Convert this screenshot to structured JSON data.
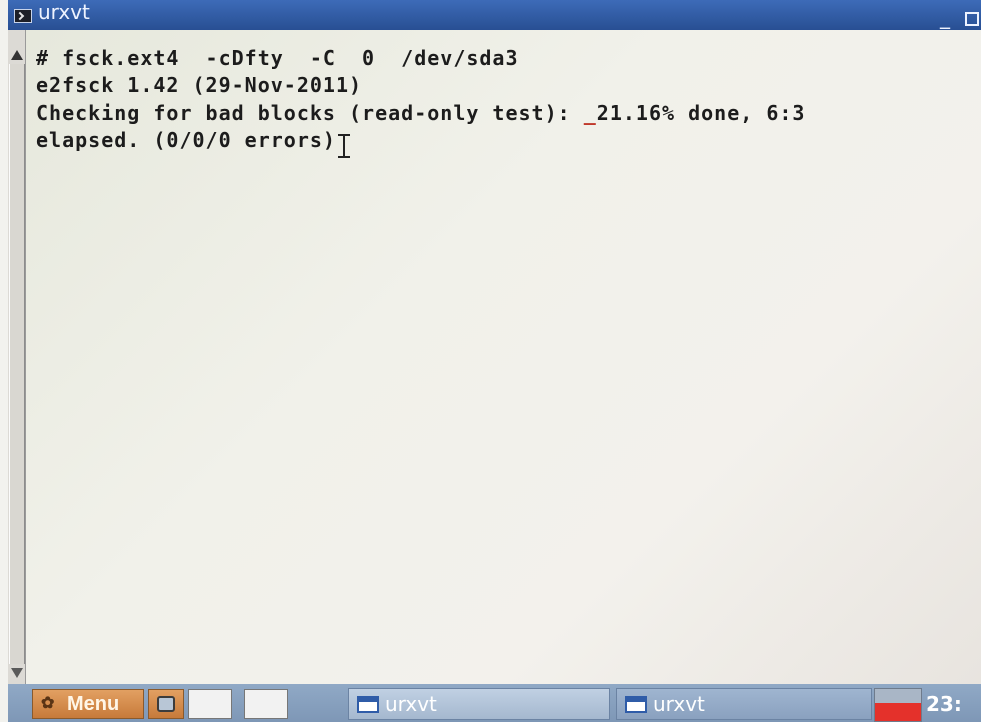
{
  "window": {
    "title": "urxvt",
    "minimize_glyph": "_",
    "icons": [
      "terminal-icon",
      "minimize-icon",
      "maximize-icon"
    ]
  },
  "terminal": {
    "lines": [
      "# fsck.ext4  -cDfty  -C  0  /dev/sda3",
      "e2fsck 1.42 (29-Nov-2011)",
      "Checking for bad blocks (read-only test): ",
      "elapsed. (0/0/0 errors)"
    ],
    "cursor_mark": "_",
    "progress_text": "21.16% done, 6:3"
  },
  "taskbar": {
    "menu_label": "Menu",
    "tasks": [
      {
        "label": "urxvt",
        "active": true
      },
      {
        "label": "urxvt",
        "active": false
      }
    ],
    "clock": "23:",
    "meter_level": 0.55,
    "colors": {
      "menu": "#d08a4a",
      "meter_fill": "#e4312b",
      "title_bar": "#2f5ca8"
    }
  }
}
